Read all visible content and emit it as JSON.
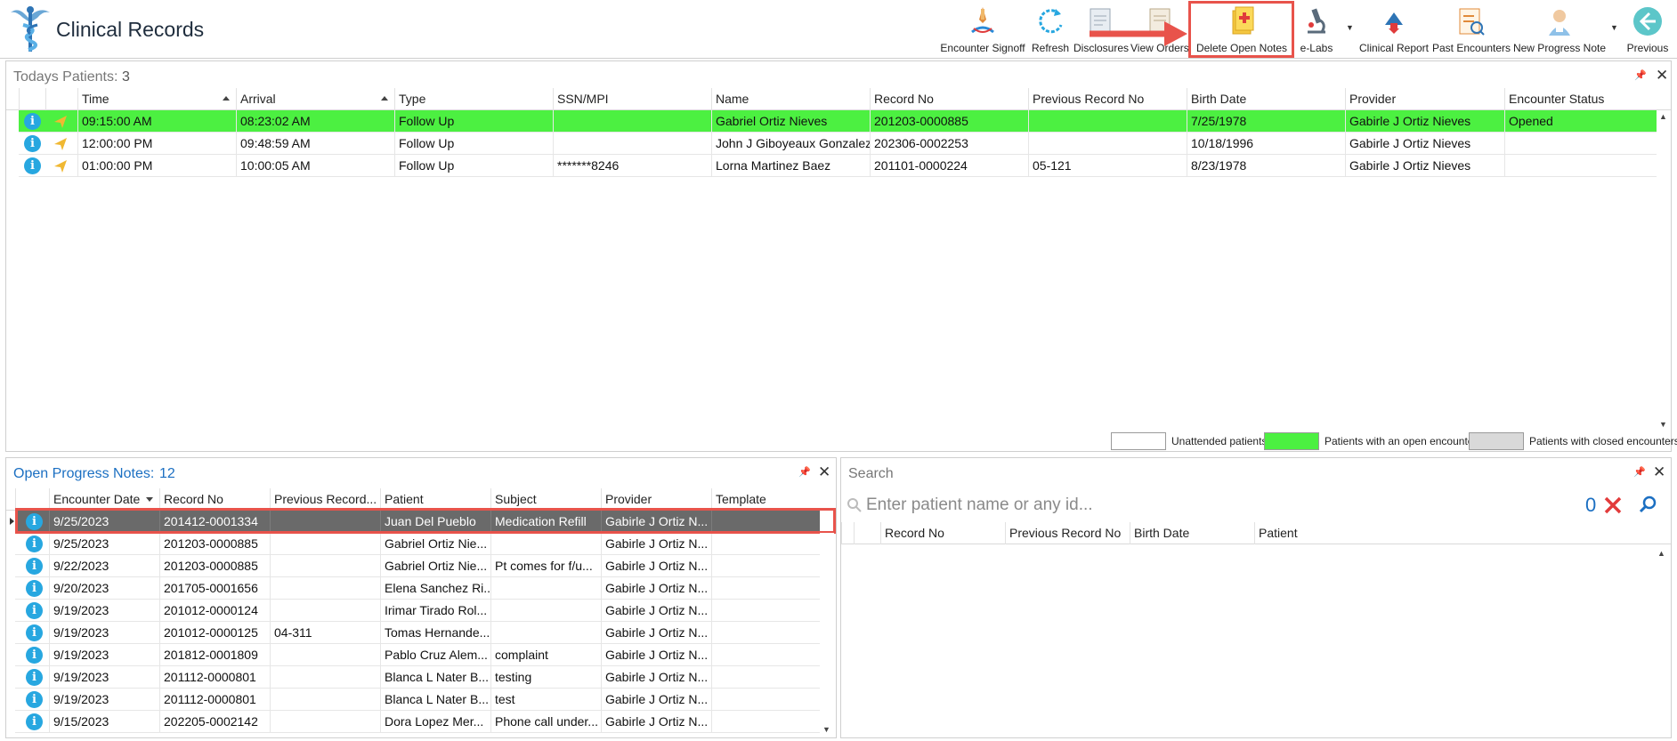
{
  "app": {
    "title": "Clinical Records"
  },
  "toolbar": {
    "buttons": [
      {
        "label": "Encounter Signoff",
        "icon": "encounter-signoff-icon"
      },
      {
        "label": "Refresh",
        "icon": "refresh-icon"
      },
      {
        "label": "Disclosures",
        "icon": "disclosures-icon"
      },
      {
        "label": "View Orders",
        "icon": "view-orders-icon"
      },
      {
        "label": "Delete Open Notes",
        "icon": "delete-open-notes-icon"
      },
      {
        "label": "e-Labs",
        "icon": "microscope-icon"
      },
      {
        "label": "Clinical Report",
        "icon": "clinical-report-icon"
      },
      {
        "label": "Past Encounters",
        "icon": "past-encounters-icon"
      },
      {
        "label": "New Progress Note",
        "icon": "new-progress-note-icon"
      },
      {
        "label": "Previous",
        "icon": "previous-arrow-icon"
      }
    ]
  },
  "todays_patients": {
    "title": "Todays Patients:",
    "count": "3",
    "columns": [
      "Time",
      "Arrival",
      "Type",
      "SSN/MPI",
      "Name",
      "Record No",
      "Previous Record No",
      "Birth Date",
      "Provider",
      "Encounter Status"
    ],
    "rows": [
      [
        "09:15:00 AM",
        "08:23:02 AM",
        "Follow Up",
        "",
        "Gabriel Ortiz Nieves",
        "201203-0000885",
        "",
        "7/25/1978",
        "Gabirle J Ortiz Nieves",
        "Opened"
      ],
      [
        "12:00:00 PM",
        "09:48:59 AM",
        "Follow Up",
        "",
        "John J Giboyeaux Gonzalez",
        "202306-0002253",
        "",
        "10/18/1996",
        "Gabirle J Ortiz Nieves",
        ""
      ],
      [
        "01:00:00 PM",
        "10:00:05 AM",
        "Follow Up",
        "*******8246",
        "Lorna Martinez Baez",
        "201101-0000224",
        "05-121",
        "8/23/1978",
        "Gabirle J Ortiz Nieves",
        ""
      ]
    ],
    "legend": {
      "unattended": "Unattended patients",
      "open": "Patients with an open encounter",
      "closed": "Patients with closed encounters"
    }
  },
  "open_notes": {
    "title": "Open Progress Notes:",
    "count": "12",
    "columns": [
      "Encounter Date",
      "Record No",
      "Previous Record...",
      "Patient",
      "Subject",
      "Provider",
      "Template"
    ],
    "rows": [
      [
        "9/25/2023",
        "201412-0001334",
        "",
        "Juan Del Pueblo",
        "Medication Refill",
        "Gabirle J Ortiz N...",
        ""
      ],
      [
        "9/25/2023",
        "201203-0000885",
        "",
        "Gabriel Ortiz Nie...",
        "",
        "Gabirle J Ortiz N...",
        ""
      ],
      [
        "9/22/2023",
        "201203-0000885",
        "",
        "Gabriel Ortiz Nie...",
        "Pt comes for f/u...",
        "Gabirle J Ortiz N...",
        ""
      ],
      [
        "9/20/2023",
        "201705-0001656",
        "",
        "Elena Sanchez Ri...",
        "",
        "Gabirle J Ortiz N...",
        ""
      ],
      [
        "9/19/2023",
        "201012-0000124",
        "",
        "Irimar Tirado Rol...",
        "",
        "Gabirle J Ortiz N...",
        ""
      ],
      [
        "9/19/2023",
        "201012-0000125",
        "04-311",
        "Tomas Hernande...",
        "",
        "Gabirle J Ortiz N...",
        ""
      ],
      [
        "9/19/2023",
        "201812-0001809",
        "",
        "Pablo Cruz Alem...",
        "complaint",
        "Gabirle J Ortiz N...",
        ""
      ],
      [
        "9/19/2023",
        "201112-0000801",
        "",
        "Blanca L Nater B...",
        "testing",
        "Gabirle J Ortiz N...",
        ""
      ],
      [
        "9/19/2023",
        "201112-0000801",
        "",
        "Blanca L Nater B...",
        "test",
        "Gabirle J Ortiz N...",
        ""
      ],
      [
        "9/15/2023",
        "202205-0002142",
        "",
        "Dora Lopez Mer...",
        "Phone call under...",
        "Gabirle J Ortiz N...",
        ""
      ]
    ]
  },
  "search": {
    "title": "Search",
    "placeholder": "Enter patient name or any id...",
    "result_count": "0",
    "columns": [
      "Record No",
      "Previous Record No",
      "Birth Date",
      "Patient"
    ]
  },
  "colors": {
    "open_row": "#4cf041",
    "closed_legend": "#d9d9d9",
    "selected_row": "#6a6a6a",
    "accent": "#1b6fc2",
    "annotation": "#e8534b"
  }
}
